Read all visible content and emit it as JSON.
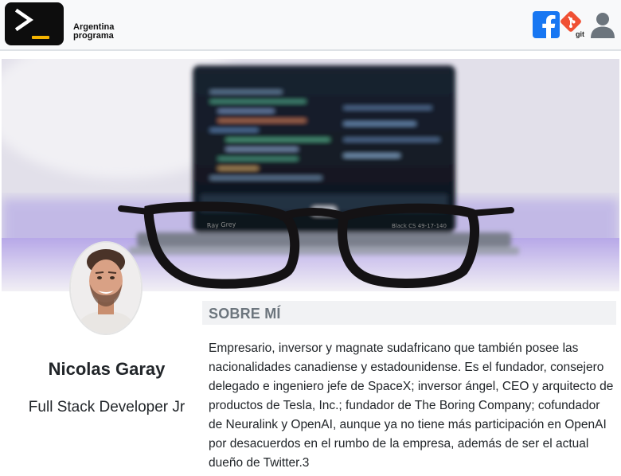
{
  "header": {
    "brand_line1": "Argentina",
    "brand_line2": "programa",
    "git_label": "git",
    "accent": "#f5b400",
    "facebook_color": "#1877f2",
    "git_color": "#f05033",
    "user_icon_color": "#6c757d"
  },
  "profile": {
    "name": "Nicolas Garay",
    "role": "Full Stack Developer Jr"
  },
  "about": {
    "title": "SOBRE MÍ",
    "text": "Empresario, inversor y magnate sudafricano que también posee las nacionalidades canadiense y estadounidense. Es el fundador, consejero delegado e ingeniero jefe de SpaceX; inversor ángel, CEO y arquitecto de productos de Tesla, Inc.; fundador de The Boring Company; cofundador de Neuralink y OpenAI, aunque ya no tiene más participación en OpenAI por desacuerdos en el rumbo de la empresa, además de ser el actual dueño de Twitter.3"
  }
}
